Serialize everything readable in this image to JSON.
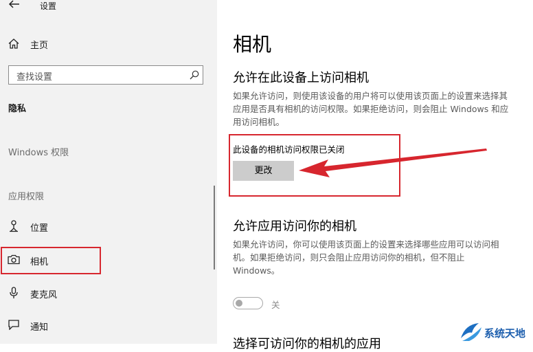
{
  "window": {
    "title": "设置"
  },
  "sidebar": {
    "home_label": "主页",
    "search_placeholder": "查找设置",
    "section_title": "隐私",
    "windows_permissions": "Windows 权限",
    "app_permissions": "应用权限",
    "items": [
      {
        "label": "位置",
        "icon": "location-icon"
      },
      {
        "label": "相机",
        "icon": "camera-icon"
      },
      {
        "label": "麦克风",
        "icon": "microphone-icon"
      },
      {
        "label": "通知",
        "icon": "notification-icon"
      }
    ]
  },
  "main": {
    "page_title": "相机",
    "section1_heading": "允许在此设备上访问相机",
    "section1_desc": [
      "如果允许访问，则使用该设备的用户将可以使用该页面上的设置来选择其",
      "应用是否具有相机的访问权限。如果拒绝访问，则会阻止 Windows 和应",
      "用访问相机。"
    ],
    "status_text": "此设备的相机访问权限已关闭",
    "change_button": "更改",
    "section2_heading": "允许应用访问你的相机",
    "section2_desc": [
      "如果允许访问，你可以使用该页面上的设置来选择哪些应用可以访问相",
      "机。如果拒绝访问，则只会阻止应用访问你的相机，但不阻止",
      "Windows。"
    ],
    "toggle_state": "关",
    "section3_heading": "选择可访问你的相机的应用"
  },
  "watermark": {
    "text": "系统天地"
  },
  "colors": {
    "highlight": "#d7262e",
    "button": "#cccccc",
    "sidebar_bg": "#f2f2f2"
  }
}
